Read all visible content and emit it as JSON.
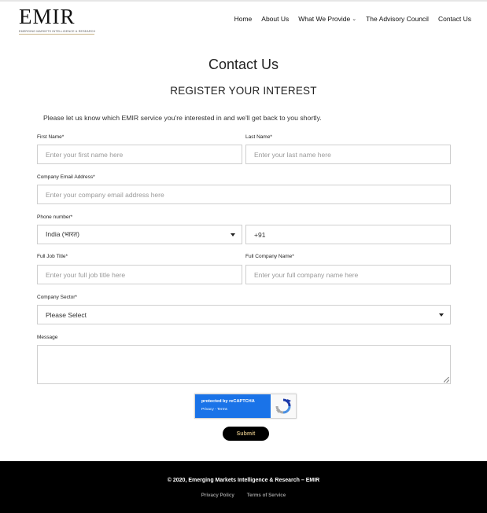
{
  "logo": {
    "main": "EMIR",
    "tagline": "EMERGING MARKETS INTELLIGENCE & RESEARCH"
  },
  "nav": {
    "items": [
      "Home",
      "About Us",
      "What We Provide",
      "The Advisory Council",
      "Contact Us"
    ]
  },
  "page": {
    "title": "Contact Us",
    "form_heading": "REGISTER YOUR INTEREST",
    "intro": "Please let us know which EMIR service you're interested in and we'll get back to you shortly."
  },
  "form": {
    "first_name": {
      "label": "First Name*",
      "placeholder": "Enter your first name here"
    },
    "last_name": {
      "label": "Last Name*",
      "placeholder": "Enter your last name here"
    },
    "email": {
      "label": "Company Email Address*",
      "placeholder": "Enter your company email address here"
    },
    "phone": {
      "label": "Phone number*",
      "country": "India (भारत)",
      "code": "+91"
    },
    "job_title": {
      "label": "Full Job Title*",
      "placeholder": "Enter your full job title here"
    },
    "company_name": {
      "label": "Full Company Name*",
      "placeholder": "Enter your full company name here"
    },
    "sector": {
      "label": "Company Sector*",
      "selected": "Please Select"
    },
    "message": {
      "label": "Message"
    },
    "submit_label": "Submit"
  },
  "captcha": {
    "title": "protected by reCAPTCHA",
    "links": "Privacy - Terms"
  },
  "footer": {
    "copyright": "© 2020, Emerging Markets Intelligence & Research – EMIR",
    "privacy": "Privacy Policy",
    "terms": "Terms of Service"
  },
  "colors": {
    "accent_gold": "#c9b07a",
    "recaptcha_blue": "#1a73e8",
    "footer_bg": "#000000"
  }
}
